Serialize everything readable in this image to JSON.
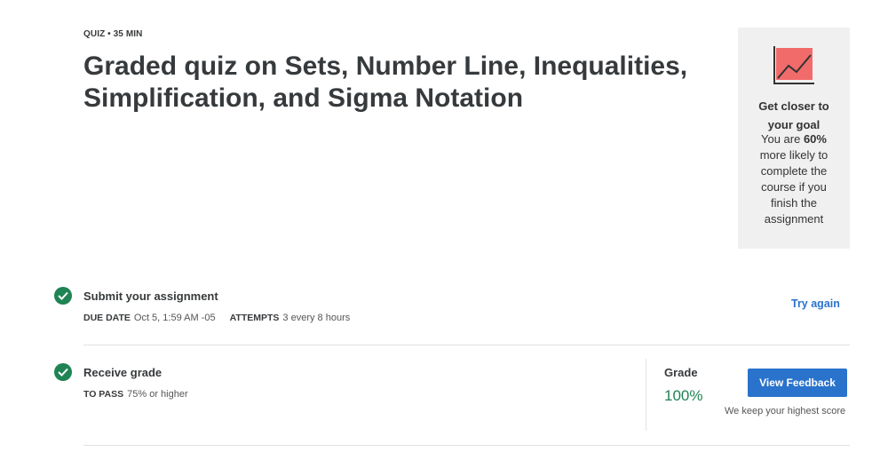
{
  "header": {
    "meta": "QUIZ • 35 MIN",
    "title": "Graded quiz on Sets, Number Line, Inequalities, Simplification, and Sigma Notation"
  },
  "goal_card": {
    "icon": "trending-chart-icon",
    "title": "Get closer to your goal",
    "body_prefix": "You are ",
    "body_highlight": "60%",
    "body_suffix": " more likely to complete the course if you finish the assignment"
  },
  "submit": {
    "title": "Submit your assignment",
    "due_label": "DUE DATE",
    "due_value": "Oct 5, 1:59 AM -05",
    "attempts_label": "ATTEMPTS",
    "attempts_value": "3 every 8 hours",
    "action_label": "Try again"
  },
  "receive": {
    "title": "Receive grade",
    "pass_label": "TO PASS",
    "pass_value": "75% or higher",
    "grade_label": "Grade",
    "grade_value": "100%",
    "button_label": "View Feedback",
    "note": "We keep your highest score"
  },
  "colors": {
    "accent_blue": "#2a73cc",
    "success_green": "#1f8354",
    "card_bg": "#f0f0f0",
    "chart_icon_fill": "#f26b6b"
  }
}
